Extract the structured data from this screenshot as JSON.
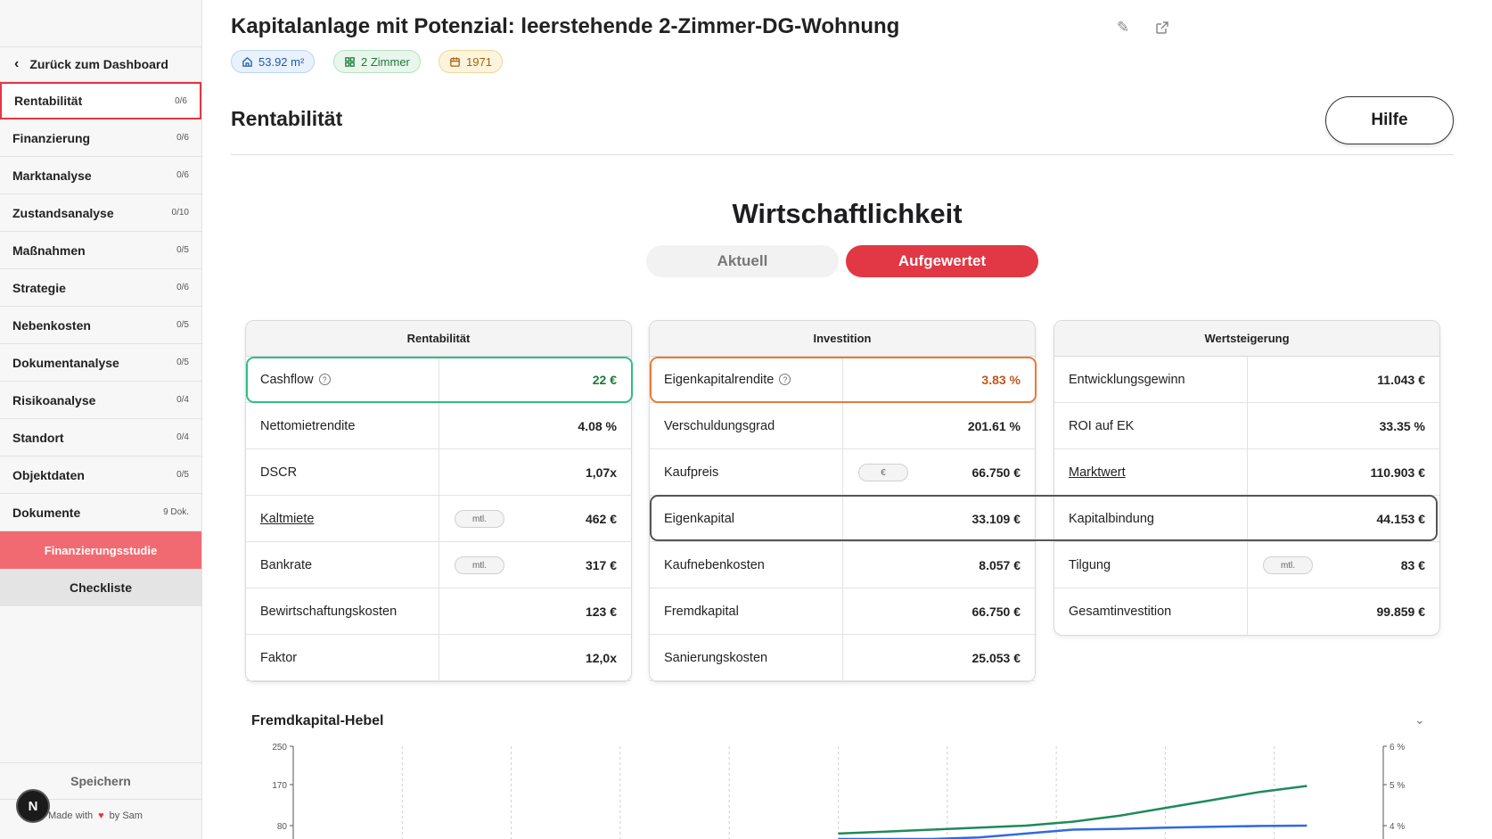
{
  "sidebar": {
    "back_label": "Zurück zum Dashboard",
    "items": [
      {
        "label": "Rentabilität",
        "count": "0/6"
      },
      {
        "label": "Finanzierung",
        "count": "0/6"
      },
      {
        "label": "Marktanalyse",
        "count": "0/6"
      },
      {
        "label": "Zustandsanalyse",
        "count": "0/10"
      },
      {
        "label": "Maßnahmen",
        "count": "0/5"
      },
      {
        "label": "Strategie",
        "count": "0/6"
      },
      {
        "label": "Nebenkosten",
        "count": "0/5"
      },
      {
        "label": "Dokumentanalyse",
        "count": "0/5"
      },
      {
        "label": "Risikoanalyse",
        "count": "0/4"
      },
      {
        "label": "Standort",
        "count": "0/4"
      },
      {
        "label": "Objektdaten",
        "count": "0/5"
      },
      {
        "label": "Dokumente",
        "count": "9 Dok."
      }
    ],
    "finanzierung_label": "Finanzierungsstudie",
    "checkliste_label": "Checkliste",
    "save_label": "Speichern",
    "made_with": "Made with",
    "by": "by Sam",
    "badge": "N"
  },
  "header": {
    "title": "Kapitalanlage mit Potenzial: leerstehende 2-Zimmer-DG-Wohnung",
    "tags": {
      "area": "53.92 m²",
      "rooms": "2 Zimmer",
      "year": "1971"
    }
  },
  "section": {
    "title": "Rentabilität",
    "help_label": "Hilfe"
  },
  "wirtschaft": {
    "title": "Wirtschaftlichkeit",
    "toggle_current": "Aktuell",
    "toggle_upgraded": "Aufgewertet"
  },
  "cards": {
    "rentabilitaet": {
      "title": "Rentabilität",
      "rows": [
        {
          "label": "Cashflow",
          "value": "22 €"
        },
        {
          "label": "Nettomietrendite",
          "value": "4.08 %"
        },
        {
          "label": "DSCR",
          "value": "1,07x"
        },
        {
          "label": "Kaltmiete",
          "value": "462 €",
          "pill": "mtl."
        },
        {
          "label": "Bankrate",
          "value": "317 €",
          "pill": "mtl."
        },
        {
          "label": "Bewirtschaftungskosten",
          "value": "123 €"
        },
        {
          "label": "Faktor",
          "value": "12,0x"
        }
      ]
    },
    "investition": {
      "title": "Investition",
      "rows": [
        {
          "label": "Eigenkapitalrendite",
          "value": "3.83 %"
        },
        {
          "label": "Verschuldungsgrad",
          "value": "201.61 %"
        },
        {
          "label": "Kaufpreis",
          "value": "66.750 €",
          "pill": "€"
        },
        {
          "label": "Eigenkapital",
          "value": "33.109 €"
        },
        {
          "label": "Kaufnebenkosten",
          "value": "8.057 €"
        },
        {
          "label": "Fremdkapital",
          "value": "66.750 €"
        },
        {
          "label": "Sanierungskosten",
          "value": "25.053 €"
        }
      ]
    },
    "wertsteigerung": {
      "title": "Wertsteigerung",
      "rows": [
        {
          "label": "Entwicklungsgewinn",
          "value": "11.043 €"
        },
        {
          "label": "ROI auf EK",
          "value": "33.35 %"
        },
        {
          "label": "Marktwert",
          "value": "110.903 €"
        },
        {
          "label": "Kapitalbindung",
          "value": "44.153 €"
        },
        {
          "label": "Tilgung",
          "value": "83 €",
          "pill": "mtl."
        },
        {
          "label": "Gesamtinvestition",
          "value": "99.859 €"
        }
      ]
    }
  },
  "colors": {
    "accent": "#e23744",
    "cashflow": "#1c7a3a",
    "ekrendite": "#c0561a",
    "green_box": "#2bbf87",
    "orange_box": "#ea7a3a"
  },
  "chart_title": "Fremdkapital-Hebel",
  "chart_data": {
    "type": "line",
    "title": "Fremdkapital-Hebel",
    "y_left_ticks": [
      "250",
      "170",
      "80"
    ],
    "y_right_ticks": [
      "6 %",
      "5 %",
      "4 %"
    ],
    "series": [
      {
        "color": "#1f8a5a",
        "x": [
          0,
          1,
          2,
          3,
          4,
          5,
          6,
          7,
          8,
          9,
          10
        ],
        "values": [
          3.8,
          3.85,
          3.9,
          3.95,
          4.0,
          4.1,
          4.25,
          4.45,
          4.65,
          4.85,
          5.0
        ]
      },
      {
        "color": "#2f6be0",
        "x": [
          0,
          1,
          2,
          3,
          4,
          5,
          6,
          7,
          8,
          9,
          10
        ],
        "values": [
          3.5,
          3.55,
          3.6,
          3.7,
          3.8,
          3.9,
          3.92,
          3.95,
          3.97,
          3.99,
          4.0
        ]
      }
    ]
  }
}
